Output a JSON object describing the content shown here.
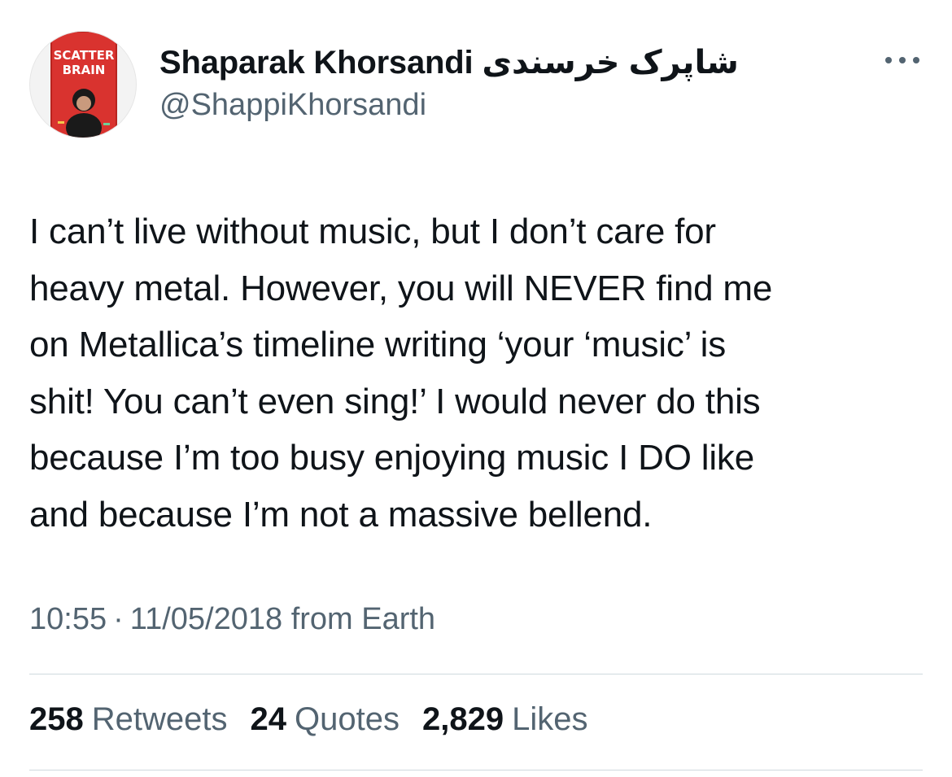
{
  "author": {
    "display_name": "Shaparak Khorsandi شاپرک خرسندی",
    "handle": "@ShappiKhorsandi",
    "avatar": {
      "title_lines": [
        "SCATTER",
        "BRAIN"
      ],
      "accent_color": "#d9332f",
      "title_color": "#ffffff"
    }
  },
  "tweet": {
    "lines": [
      "I can’t live without music, but I don’t care for",
      "heavy metal. However, you will NEVER find me",
      "on Metallica’s timeline writing ‘your ‘music’ is",
      "shit! You can’t even sing!’ I would never do this",
      "because I’m too busy enjoying music I DO like",
      "and because I’m not a massive bellend."
    ],
    "time": "10:55",
    "separator": "·",
    "date": "11/05/2018",
    "source": "from Earth"
  },
  "stats": {
    "retweets": {
      "count": "258",
      "label": "Retweets"
    },
    "quotes": {
      "count": "24",
      "label": "Quotes"
    },
    "likes": {
      "count": "2,829",
      "label": "Likes"
    }
  },
  "icons": {
    "more": "more-horizontal-icon"
  },
  "colors": {
    "text": "#0f1419",
    "secondary": "#536471",
    "divider": "#cfd9de"
  }
}
